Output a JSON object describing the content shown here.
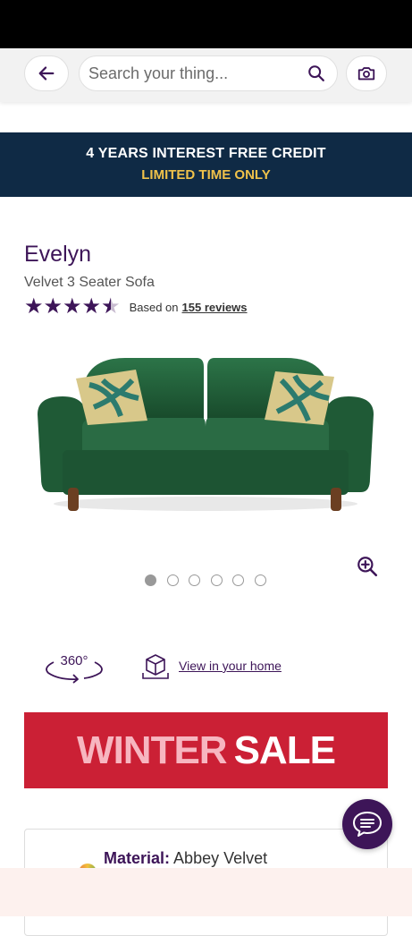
{
  "search": {
    "placeholder": "Search your thing..."
  },
  "banner": {
    "line1": "4 YEARS INTEREST FREE CREDIT",
    "line2": "LIMITED TIME ONLY"
  },
  "product": {
    "title": "Evelyn",
    "subtitle": "Velvet 3 Seater Sofa",
    "rating": 4.5,
    "based_on": "Based on",
    "reviews_link": "155 reviews"
  },
  "gallery": {
    "image_count": 6,
    "active_index": 0
  },
  "view360": {
    "label": "360°"
  },
  "home_view": {
    "label": "View in your home"
  },
  "sale": {
    "word1": "WINTER",
    "word2": "SALE"
  },
  "info": {
    "material_label": "Material:",
    "material_value": "Abbey Velvet"
  },
  "colors": {
    "brand_purple": "#3d1558",
    "banner_navy": "#0f2a45",
    "banner_yellow": "#f0c24a",
    "sale_red": "#cb2035",
    "sofa_green": "#1f5a36"
  },
  "icons": [
    "back-arrow-icon",
    "search-icon",
    "camera-icon",
    "star-icon",
    "zoom-in-icon",
    "rotate-360-icon",
    "ar-box-icon",
    "chat-icon"
  ]
}
